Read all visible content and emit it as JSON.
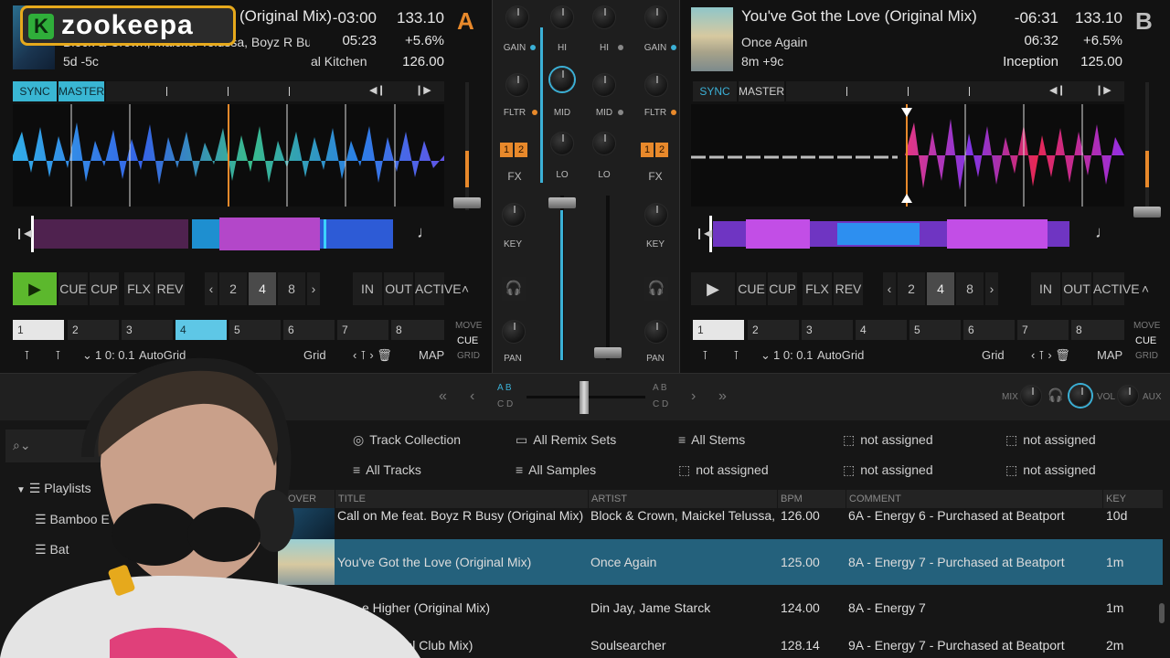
{
  "branding": {
    "logo_letter": "K",
    "logo_text": "zookeepa"
  },
  "deck_a": {
    "letter": "A",
    "title": "(Original Mix)",
    "artist": "Block & Crown, Maickel Telussa, Boyz R Busy",
    "album": "al Kitchen",
    "key_info": "5d -5c",
    "remaining": "-03:00",
    "elapsed": "05:23",
    "bpm": "133.10",
    "pitch": "+5.6%",
    "track_bpm": "126.00",
    "sync_label": "SYNC",
    "master_label": "MASTER",
    "transport": {
      "cue": "CUE",
      "cup": "CUP",
      "flx": "FLX",
      "rev": "REV"
    },
    "loop_sizes": [
      "2",
      "4",
      "8"
    ],
    "loop_in": "IN",
    "loop_out": "OUT",
    "loop_active": "ACTIVE",
    "cues": [
      "1",
      "2",
      "3",
      "4",
      "5",
      "6",
      "7",
      "8"
    ],
    "move_label": "MOVE",
    "move_mode": "CUE",
    "move_grid": "GRID",
    "beat_pos": "1 0: 0.1",
    "grid_mode": "AutoGrid",
    "grid_label": "Grid",
    "map_label": "MAP"
  },
  "deck_b": {
    "letter": "B",
    "title": "You've Got the Love (Original Mix)",
    "artist": "Once Again",
    "album": "Inception",
    "key_info": "8m +9c",
    "remaining": "-06:31",
    "elapsed": "06:32",
    "bpm": "133.10",
    "pitch": "+6.5%",
    "track_bpm": "125.00",
    "sync_label": "SYNC",
    "master_label": "MASTER",
    "transport": {
      "cue": "CUE",
      "cup": "CUP",
      "flx": "FLX",
      "rev": "REV"
    },
    "loop_sizes": [
      "2",
      "4",
      "8"
    ],
    "loop_in": "IN",
    "loop_out": "OUT",
    "loop_active": "ACTIVE",
    "cues": [
      "1",
      "2",
      "3",
      "4",
      "5",
      "6",
      "7",
      "8"
    ],
    "move_label": "MOVE",
    "move_mode": "CUE",
    "move_grid": "GRID",
    "beat_pos": "1 0: 0.1",
    "grid_mode": "AutoGrid",
    "grid_label": "Grid",
    "map_label": "MAP"
  },
  "mixer": {
    "gain": "GAIN",
    "hi": "HI",
    "mid": "MID",
    "lo": "LO",
    "fltr": "FLTR",
    "fx": "FX",
    "key": "KEY",
    "pan": "PAN",
    "fx1": "1",
    "fx2": "2",
    "assign_top": "A B",
    "assign_bottom": "C D"
  },
  "master_section": {
    "mix": "MIX",
    "vol": "VOL",
    "aux": "AUX"
  },
  "browser": {
    "favorites": [
      "Track Collection",
      "All Remix Sets",
      "All Stems",
      "not assigned",
      "not assigned",
      "All Tracks",
      "All Samples",
      "not assigned",
      "not assigned",
      "not assigned"
    ],
    "tree": {
      "playlists": "Playlists",
      "item1": "Bamboo E",
      "item2": "Bat"
    },
    "columns": {
      "cover": "COVER ART",
      "title": "TITLE",
      "artist": "ARTIST",
      "bpm": "BPM",
      "comment": "COMMENT",
      "key": "KEY"
    },
    "rows": [
      {
        "title": "Call on Me feat. Boyz R Busy (Original Mix)",
        "artist": "Block & Crown, Maickel Telussa, B~",
        "bpm": "126.00",
        "comment": "6A - Energy 6 - Purchased at Beatport",
        "key": "10d"
      },
      {
        "title": "You've Got the Love (Original Mix)",
        "artist": "Once Again",
        "bpm": "125.00",
        "comment": "8A - Energy 7 - Purchased at Beatport",
        "key": "1m"
      },
      {
        "title": "e Higher (Original Mix)",
        "artist": "Din Jay, Jame Starck",
        "bpm": "124.00",
        "comment": "8A - Energy 7",
        "key": "1m"
      },
      {
        "title": "gh (Vocal Club Mix)",
        "artist": "Soulsearcher",
        "bpm": "128.14",
        "comment": "9A - Energy 7 - Purchased at Beatport",
        "key": "2m"
      }
    ]
  },
  "colors": {
    "sync": "#39b6d3",
    "play": "#5cb82d",
    "accent_orange": "#e8892b",
    "selected_row": "#24617c"
  }
}
